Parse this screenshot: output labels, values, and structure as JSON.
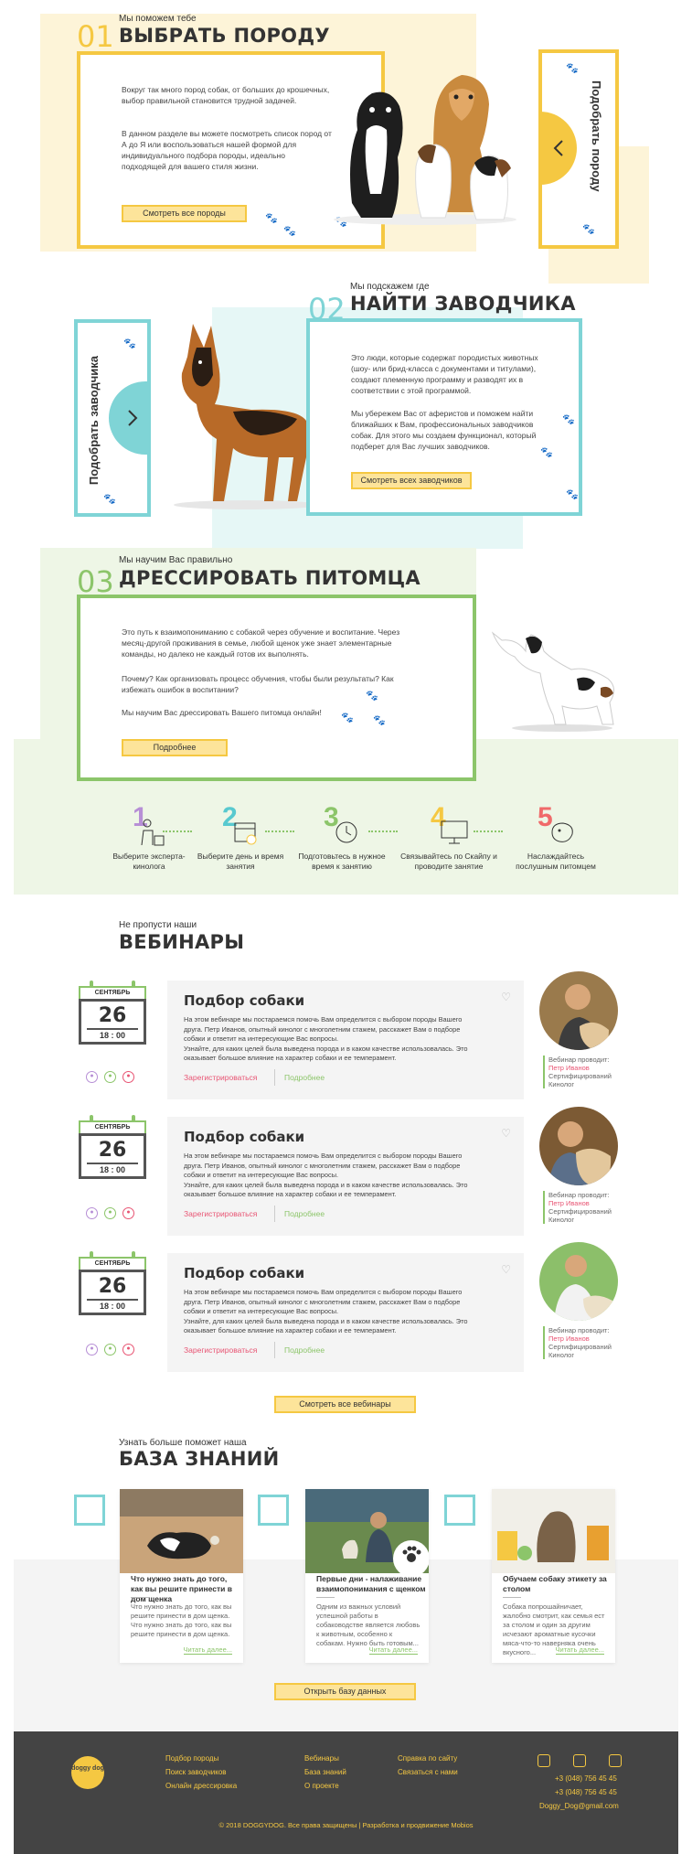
{
  "sections": {
    "breed": {
      "num": "01",
      "sub": "Мы поможем тебе",
      "title": "ВЫБРАТЬ ПОРОДУ",
      "p1": "Вокруг так много пород собак, от больших до крошечных, выбор правильной становится трудной задачей.",
      "p2": "В данном разделе вы можете посмотреть список пород от А до Я или воспользоваться нашей формой для индивидуального подбора породы, идеально подходящей для вашего стиля жизни.",
      "button": "Смотреть все породы",
      "side_tab": "Подобрать породу"
    },
    "breeder": {
      "num": "02",
      "sub": "Мы подскажем где",
      "title": "НАЙТИ ЗАВОДЧИКА",
      "p1": "Это люди, которые содержат породистых животных (шоу- или брид-класса с документами и титулами), создают племенную программу и разводят их в соответствии с этой программой.",
      "p2": "Мы убережем Вас от аферистов и поможем найти ближайших к Вам, профессиональных заводчиков собак. Для этого мы создаем функционал, который подберет для Вас лучших заводчиков.",
      "button": "Смотреть всех заводчиков",
      "side_tab": "Подобрать заводчика"
    },
    "training": {
      "num": "03",
      "sub": "Мы научим Вас правильно",
      "title": "ДРЕССИРОВАТЬ ПИТОМЦА",
      "p1": "Это путь к взаимопониманию с собакой через обучение и воспитание. Через месяц-другой проживания в семье, любой щенок уже знает элементарные команды, но далеко не каждый готов их выполнять.",
      "p2": "Почему? Как организовать процесс обучения, чтобы были результаты? Как избежать ошибок в воспитании?",
      "p3": "Мы научим Вас дрессировать Вашего питомца онлайн!",
      "button": "Подробнее"
    }
  },
  "steps": [
    {
      "num": "1",
      "label": "Выберите эксперта-кинолога",
      "color": "#b78fd6"
    },
    {
      "num": "2",
      "label": "Выберите день и время занятия",
      "color": "#58c9cf"
    },
    {
      "num": "3",
      "label": "Подготовьтесь в нужное время к занятию",
      "color": "#8cc56a"
    },
    {
      "num": "4",
      "label": "Связывайтесь по Скайпу и проводите занятие",
      "color": "#f5c842"
    },
    {
      "num": "5",
      "label": "Наслаждайтесь послушным питомцем",
      "color": "#f06a6a"
    }
  ],
  "webinars": {
    "sub": "Не пропусти наши",
    "title": "ВЕБИНАРЫ",
    "items": [
      {
        "month": "СЕНТЯБРЬ",
        "day": "26",
        "time": "18 : 00",
        "title": "Подбор собаки",
        "text": "На этом вебинаре мы постараемся помочь Вам определится с выбором породы Вашего друга. Петр Иванов, опытный кинолог с многолетним стажем, расскажет Вам о подборе собаки и ответит на интересующие Вас вопросы.",
        "text2": "Узнайте, для каких целей была выведена порода и в каком качестве использовалась. Это оказывает большое влияние на характер собаки и ее темперамент.",
        "register": "Зарегистрироваться",
        "more": "Подробнее",
        "host_label": "Вебинар проводит:",
        "host_name": "Петр Иванов",
        "host_role": "Сертифицирований Кинолог"
      },
      {
        "month": "СЕНТЯБРЬ",
        "day": "26",
        "time": "18 : 00",
        "title": "Подбор собаки",
        "text": "На этом вебинаре мы постараемся помочь Вам определится с выбором породы Вашего друга. Петр Иванов, опытный кинолог с многолетним стажем, расскажет Вам о подборе собаки и ответит на интересующие Вас вопросы.",
        "text2": "Узнайте, для каких целей была выведена порода и в каком качестве использовалась. Это оказывает большое влияние на характер собаки и ее темперамент.",
        "register": "Зарегистрироваться",
        "more": "Подробнее",
        "host_label": "Вебинар проводит:",
        "host_name": "Петр Иванов",
        "host_role": "Сертифицирований Кинолог"
      },
      {
        "month": "СЕНТЯБРЬ",
        "day": "26",
        "time": "18 : 00",
        "title": "Подбор собаки",
        "text": "На этом вебинаре мы постараемся помочь Вам определится с выбором породы Вашего друга. Петр Иванов, опытный кинолог с многолетним стажем, расскажет Вам о подборе собаки и ответит на интересующие Вас вопросы.",
        "text2": "Узнайте, для каких целей была выведена порода и в каком качестве использовалась. Это оказывает большое влияние на характер собаки и ее темперамент.",
        "register": "Зарегистрироваться",
        "more": "Подробнее",
        "host_label": "Вебинар проводит:",
        "host_name": "Петр Иванов",
        "host_role": "Сертифицирований Кинолог"
      }
    ],
    "all_button": "Смотреть все вебинары"
  },
  "knowledge": {
    "sub": "Узнать больше поможет наша",
    "title": "БАЗА ЗНАНИЙ",
    "cards": [
      {
        "title": "Что нужно знать до того, как вы решите принести в дом щенка",
        "text": "Что нужно знать до того, как вы решите принести в дом щенка. Что нужно знать до того, как вы решите принести в дом щенка.",
        "read": "Читать далее..."
      },
      {
        "title": "Первые дни - налаживание взаимопонимания с щенком",
        "text": "Одним из важных условий успешной работы в собаководстве является любовь к животным, особенно к собакам. Нужно быть готовым...",
        "read": "Читать далее..."
      },
      {
        "title": "Обучаем собаку этикету за столом",
        "text": "Собака попрошайничает, жалобно смотрит, как семья ест за столом и один за другим исчезают ароматные кусочки мяса-что-то наверняка очень вкусного...",
        "read": "Читать далее..."
      }
    ],
    "button": "Открыть базу данных"
  },
  "footer": {
    "logo": "doggy dog",
    "col1": [
      "Подбор породы",
      "Поиск заводчиков",
      "Онлайн дрессировка"
    ],
    "col2": [
      "Вебинары",
      "База знаний",
      "О проекте"
    ],
    "col3": [
      "Справка по сайту",
      "Связаться с нами"
    ],
    "phones": [
      "+3 (048) 756 45 45",
      "+3 (048) 756 45 45"
    ],
    "email": "Doggy_Dog@gmail.com",
    "copyright": "© 2018 DOGGYDOG. Все права защищены | Разработка и продвижение Mobios",
    "social_icons": [
      "instagram-icon",
      "vk-icon",
      "facebook-icon"
    ]
  },
  "colors": {
    "yellow": "#f5c842",
    "teal": "#7fd4d6",
    "green": "#8cc56a",
    "pink": "#e85473"
  }
}
